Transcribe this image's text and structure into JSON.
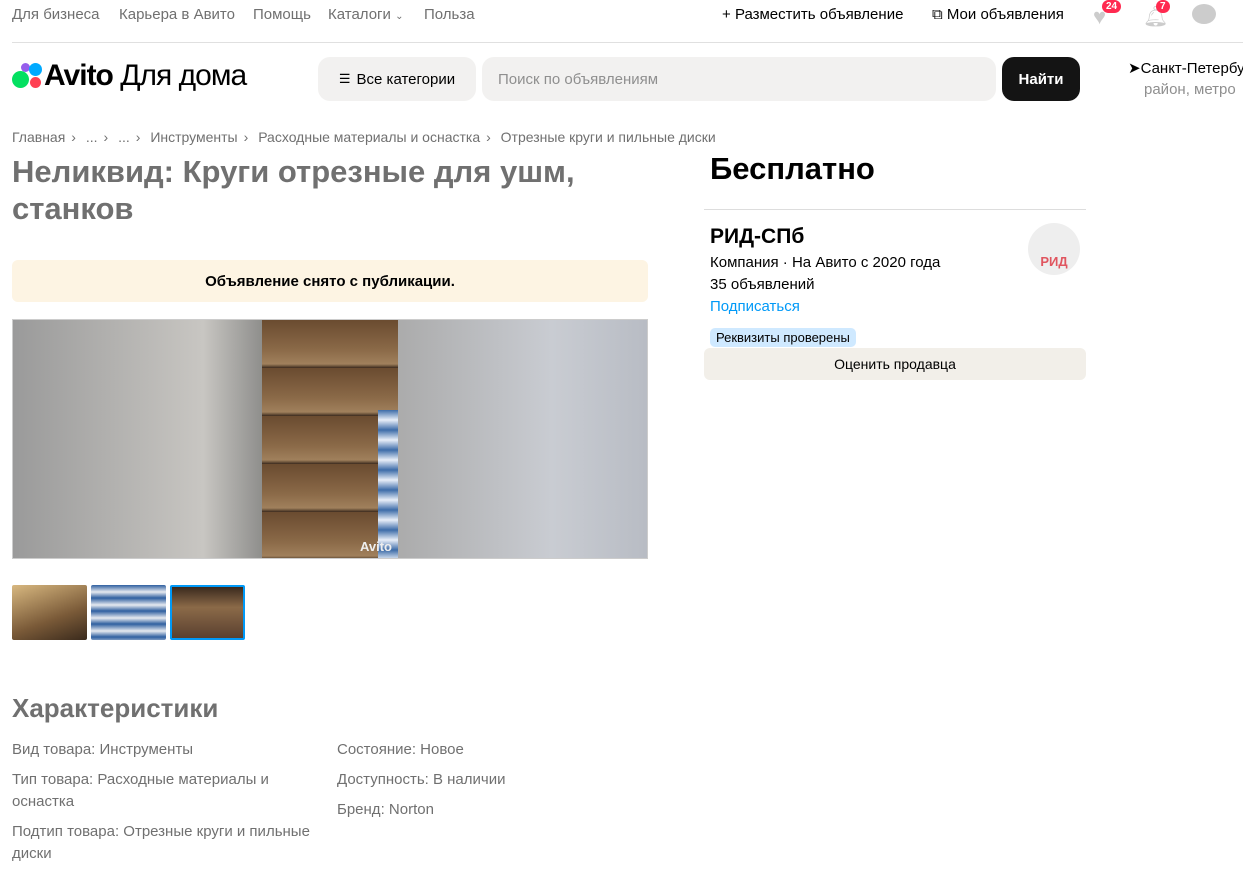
{
  "topbar": {
    "links": [
      "Для бизнеса",
      "Карьера в Авито",
      "Помощь",
      "Каталоги",
      "Польза"
    ],
    "post_ad": "Разместить объявление",
    "my_ads": "Мои объявления",
    "favorites_count": "24",
    "notifications_count": "7"
  },
  "header": {
    "logo": "Avito",
    "logo_suffix": "Для дома",
    "categories_button": "Все категории",
    "search_placeholder": "Поиск по объявлениям",
    "search_button": "Найти",
    "location": "Санкт-Петербург",
    "location_sub": "район, метро"
  },
  "breadcrumbs": [
    "Главная",
    "...",
    "...",
    "Инструменты",
    "Расходные материалы и оснастка",
    "Отрезные круги и пильные диски"
  ],
  "listing": {
    "title": "Неликвид: Круги отрезные для ушм, станков",
    "notice": "Объявление снято с публикации.",
    "watermark": "Avito",
    "price": "Бесплатно"
  },
  "seller": {
    "name": "РИД-СПб",
    "info": "Компания · На Авито с 2020 года",
    "ads_count": "35 объявлений",
    "subscribe": "Подписаться",
    "verified": "Реквизиты проверены",
    "rate": "Оценить продавца",
    "avatar_text": "РИД"
  },
  "specs": {
    "title": "Характеристики",
    "left": [
      "Вид товара: Инструменты",
      "Тип товара: Расходные материалы и оснастка",
      "Подтип товара: Отрезные круги и пильные диски"
    ],
    "right": [
      "Состояние: Новое",
      "Доступность: В наличии",
      "Бренд: Norton"
    ]
  },
  "colors": {
    "accent": "#0099f7",
    "badge": "#ff2a50"
  }
}
